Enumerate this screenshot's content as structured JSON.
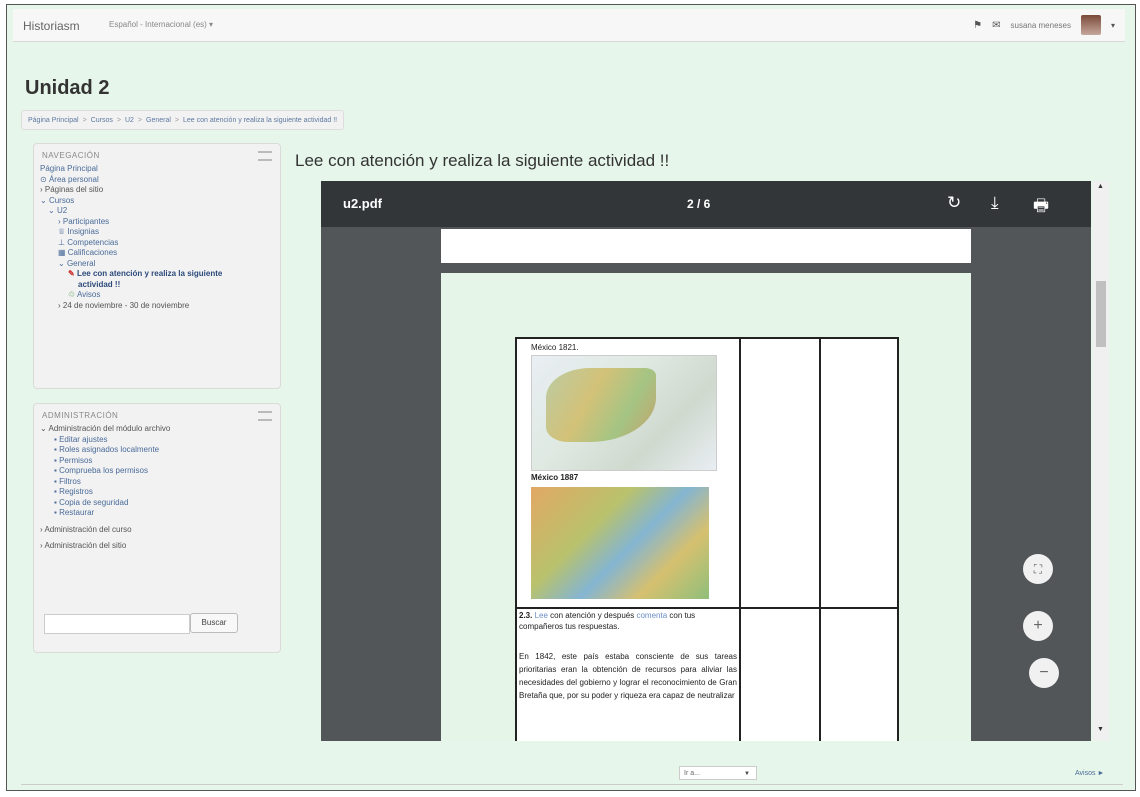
{
  "header": {
    "brand": "Historiasm",
    "language": "Español - Internacional (es) ▾",
    "user_name": "susana meneses",
    "icons": [
      "home-icon",
      "message-icon",
      "avatar",
      "caret-icon"
    ]
  },
  "page": {
    "title": "Unidad 2",
    "breadcrumb": [
      "Página Principal",
      "Cursos",
      "U2",
      "General",
      "Lee con atención y realiza la siguiente actividad !!"
    ]
  },
  "navigation": {
    "heading": "NAVEGACIÓN",
    "items": [
      "Página Principal",
      "Área personal",
      "Páginas del sitio",
      "Cursos",
      "U2",
      "Participantes",
      "Insignias",
      "Competencias",
      "Calificaciones",
      "General",
      "Lee con atención y realiza la siguiente",
      "actividad !!",
      "Avisos",
      "24 de noviembre - 30 de noviembre"
    ]
  },
  "administration": {
    "heading": "ADMINISTRACIÓN",
    "items": [
      "Administración del módulo archivo",
      "Editar ajustes",
      "Roles asignados localmente",
      "Permisos",
      "Comprueba los permisos",
      "Filtros",
      "Registros",
      "Copia de seguridad",
      "Restaurar",
      "Administración del curso",
      "Administración del sitio"
    ],
    "search_button": "Buscar",
    "search_value": ""
  },
  "activity": {
    "title": "Lee con atención y realiza la siguiente actividad !!"
  },
  "viewer": {
    "file_name": "u2.pdf",
    "page_indicator": "2 / 6",
    "icons": [
      "rotate-icon",
      "download-icon",
      "print-icon",
      "fit-page-icon",
      "zoom-in-icon",
      "zoom-out-icon"
    ],
    "zoom_in": "+",
    "zoom_out": "−",
    "fit": "⛶",
    "rotate": "↻",
    "download": "⤓",
    "print": "🖶"
  },
  "document": {
    "caption1": "México 1821.",
    "caption2": "México 1887",
    "p1_num": "2.3.",
    "p1_word1": "Lee",
    "p1_mid": "con atención y después",
    "p1_word2": "comenta",
    "p1_end": "con tus compañeros tus respuestas.",
    "p2": "En 1842, este país estaba consciente de sus tareas prioritarias eran la obtención de recursos para aliviar las necesidades del gobierno y lograr el reconocimiento de Gran Bretaña que, por su poder y riqueza era capaz de neutralizar"
  },
  "footer": {
    "jump_placeholder": "Ir a...",
    "next_link": "Avisos ►"
  }
}
